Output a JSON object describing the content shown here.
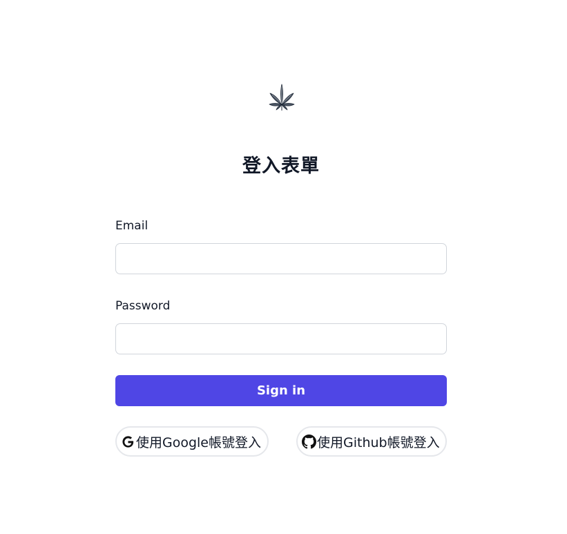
{
  "logo": {
    "icon": "leaf-icon"
  },
  "form": {
    "title": "登入表單",
    "email": {
      "label": "Email",
      "value": "",
      "placeholder": ""
    },
    "password": {
      "label": "Password",
      "value": "",
      "placeholder": ""
    },
    "submit_label": "Sign in"
  },
  "oauth": {
    "google": {
      "label": "使用Google帳號登入",
      "icon": "google-icon"
    },
    "github": {
      "label": "使用Github帳號登入",
      "icon": "github-icon"
    }
  },
  "colors": {
    "primary": "#4f46e5",
    "text": "#111827",
    "border": "#d1d5db"
  }
}
